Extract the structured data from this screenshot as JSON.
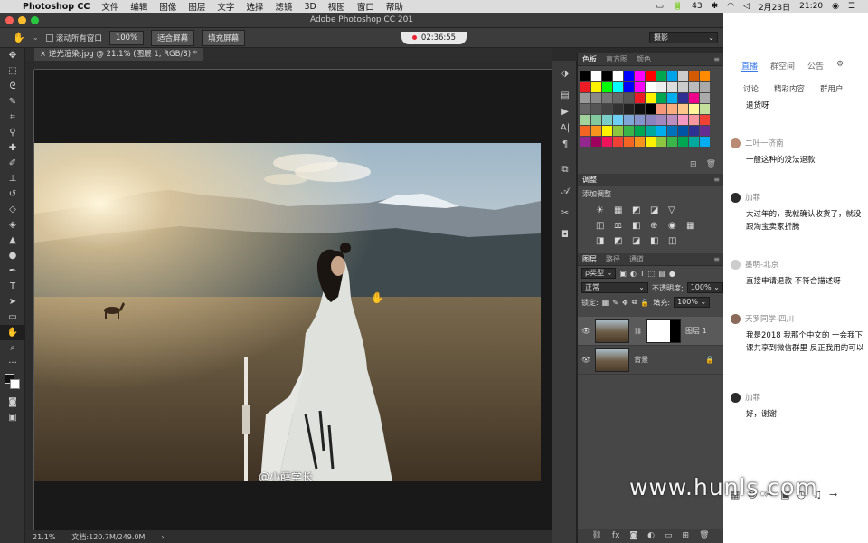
{
  "menubar": {
    "app": "Photoshop CC",
    "items": [
      "文件",
      "编辑",
      "图像",
      "图层",
      "文字",
      "选择",
      "滤镜",
      "3D",
      "视图",
      "窗口",
      "帮助"
    ],
    "battery": "43",
    "date": "2月23日",
    "time": "21:20"
  },
  "window": {
    "title": "Adobe Photoshop CC 201",
    "recording": "02:36:55"
  },
  "options": {
    "scroll_all": "滚动所有窗口",
    "zoom": "100%",
    "fit": "适合屏幕",
    "fill": "填充屏幕",
    "workspace": "摄影"
  },
  "document": {
    "tab": "逆光渲染.jpg @ 21.1% (图层 1, RGB/8) *",
    "photo_watermark": "@小薛学长",
    "zoom": "21.1%",
    "doc_size": "文档:120.7M/249.0M"
  },
  "swatches_panel": {
    "tabs": [
      "色板",
      "直方图",
      "颜色"
    ],
    "colors": [
      "#000000",
      "#ffffff",
      "#000000",
      "#ffffff",
      "#0000ff",
      "#ff00ff",
      "#ff0000",
      "#00a650",
      "#00a2e8",
      "#cccccc",
      "#d45a00",
      "#ff8c00",
      "#ed1c24",
      "#fff200",
      "#00ff00",
      "#00ffff",
      "#0000ff",
      "#ff00ff",
      "#ffffff",
      "#eeeeee",
      "#dddddd",
      "#cccccc",
      "#bbbbbb",
      "#aaaaaa",
      "#999999",
      "#888888",
      "#777777",
      "#666666",
      "#555555",
      "#ed1c24",
      "#fff200",
      "#00a651",
      "#00aeef",
      "#2e3192",
      "#ec008c",
      "#aaaaaa",
      "#666666",
      "#555555",
      "#444444",
      "#333333",
      "#222222",
      "#111111",
      "#000000",
      "#f7977a",
      "#f9ad81",
      "#fdc68a",
      "#fff79a",
      "#c4df9b",
      "#a3d39c",
      "#82ca9d",
      "#7bcdc8",
      "#6ecff6",
      "#7ea7d8",
      "#8493ca",
      "#8882be",
      "#a187be",
      "#bc8dbf",
      "#f49ac2",
      "#f6989d",
      "#ef4136",
      "#f26522",
      "#f7941d",
      "#fff200",
      "#8dc63f",
      "#39b54a",
      "#00a651",
      "#00a99d",
      "#00aeef",
      "#0072bc",
      "#0054a6",
      "#2e3192",
      "#662d91",
      "#92278f",
      "#9e005d",
      "#ed145b",
      "#ef4136",
      "#f26522",
      "#f7941d",
      "#fff200",
      "#8dc63f",
      "#39b54a",
      "#00a651",
      "#00a99d",
      "#00aeef"
    ]
  },
  "adjustments_panel": {
    "tab": "调整",
    "add_label": "添加调整",
    "icons": [
      "☀",
      "▦",
      "◩",
      "◪",
      "▽",
      "",
      "◫",
      "⚖",
      "◧",
      "⊕",
      "◉",
      "▦",
      "◨",
      "◩",
      "◪",
      "◧",
      "◫",
      ""
    ]
  },
  "layers_panel": {
    "tabs": [
      "图层",
      "路径",
      "通道"
    ],
    "kind": "ρ类型",
    "blend_mode": "正常",
    "opacity_label": "不透明度:",
    "opacity": "100%",
    "lock_label": "锁定:",
    "fill_label": "填充:",
    "fill": "100%",
    "layers": [
      {
        "name": "图层 1",
        "active": true
      },
      {
        "name": "背景",
        "active": false
      }
    ]
  },
  "chat": {
    "tabs": [
      "直播",
      "群空间",
      "公告"
    ],
    "subtabs": [
      "讨论",
      "精彩内容",
      "群用户"
    ],
    "messages": [
      {
        "user": "",
        "text": "退货呀"
      },
      {
        "user": "二叶一济南",
        "text": "一般这种的没法退款"
      },
      {
        "user": "加菲",
        "text": "大过年的，我就确认收货了，就没跟淘宝卖家折腾"
      },
      {
        "user": "墨明-北京",
        "text": "直接申请退款 不符合描述呀"
      },
      {
        "user": "天罗同学-四川",
        "text": "我是2018 我那个中文的 一会我下课共享到微信群里 反正我用的可以"
      },
      {
        "user": "加菲",
        "text": "好，谢谢"
      }
    ]
  },
  "site_watermark": "www.hunls.com",
  "colors": {
    "ps_bg": "#2b2b2b",
    "panel_bg": "#474747",
    "accent_blue": "#3b78e7"
  }
}
